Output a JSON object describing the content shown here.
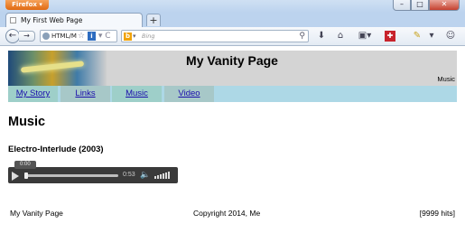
{
  "browser": {
    "app_button": "Firefox",
    "tab_title": "My First Web Page",
    "new_tab_label": "+",
    "url": "HTML/M",
    "search_placeholder": "Bing",
    "window_controls": {
      "minimize": "–",
      "maximize": "□",
      "close": "✕"
    },
    "icons": {
      "back": "←",
      "forward": "→",
      "star": "☆",
      "info": "i",
      "dropdown": "▾",
      "reload": "C",
      "search": "⚲",
      "download": "⬇",
      "home": "⌂",
      "bookmarks": "▣▾",
      "addon_red": "✚",
      "tools": "✎",
      "menu": "▾",
      "account": "☺"
    }
  },
  "page": {
    "banner": {
      "title": "My Vanity Page",
      "subtitle": "Music"
    },
    "nav": [
      "My Story",
      "Links",
      "Music",
      "Video"
    ],
    "heading": "Music",
    "song_title": "Electro-Interlude (2003)",
    "player": {
      "position_label": "0:00",
      "duration": "0:53",
      "volume_icon": "🔈",
      "progress": 0
    },
    "footer": {
      "left": "My Vanity Page",
      "center": "Copyright 2014, Me",
      "right": "[9999 hits]"
    }
  }
}
